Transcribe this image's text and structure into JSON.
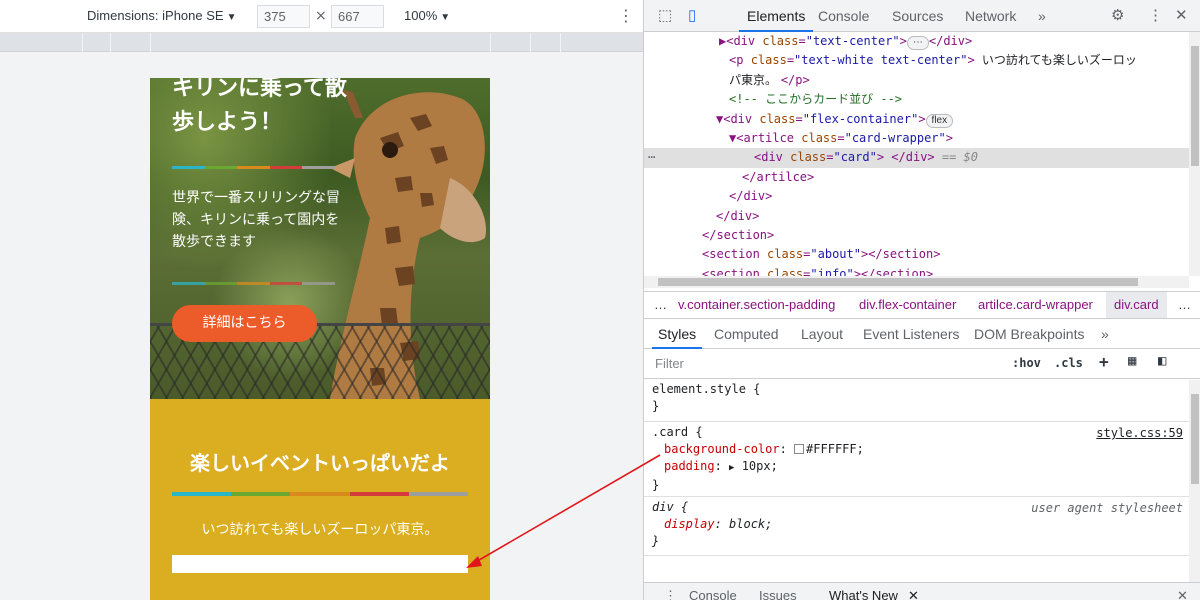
{
  "device_toolbar": {
    "dimensions_label": "Dimensions: iPhone SE",
    "width_value": "375",
    "times": "×",
    "height_value": "667",
    "zoom_label": "100%"
  },
  "page": {
    "hero_title": "キリンに乗って散歩しよう！",
    "hero_text": "世界で一番スリリングな冒険、キリンに乗って園内を散歩できます",
    "cta_label": "詳細はこちら",
    "events_title": "楽しいイベントいっぱいだよ",
    "events_text": "いつ訪れても楽しいズーロッパ東京。",
    "colors": {
      "events_bg": "#dbae22",
      "cta_bg": "#ec5b2a",
      "bar": [
        "#2bb5c8",
        "#6aa832",
        "#d88a1c",
        "#d63b3b",
        "#9e9e9e"
      ]
    }
  },
  "devtools": {
    "tabs": [
      "Elements",
      "Console",
      "Sources",
      "Network"
    ],
    "more": "»",
    "dom_lines": [
      {
        "parts": [
          [
            "tag",
            "▶<div "
          ],
          [
            "attr",
            "class"
          ],
          [
            "tag",
            "="
          ],
          [
            "val",
            "\"text-center\""
          ],
          [
            "tag",
            ">"
          ],
          [
            "pill",
            "⋯"
          ],
          [
            "tag",
            "</div>"
          ]
        ]
      },
      {
        "parts": [
          [
            "tag",
            "<p "
          ],
          [
            "attr",
            "class"
          ],
          [
            "tag",
            "="
          ],
          [
            "val",
            "\"text-white text-center\""
          ],
          [
            "tag",
            "> "
          ],
          [
            "txt",
            "いつ訪れても楽しいズーロッ"
          ]
        ]
      },
      {
        "parts": [
          [
            "txt",
            "パ東京。 "
          ],
          [
            "tag",
            "</p>"
          ]
        ]
      },
      {
        "parts": [
          [
            "cmt",
            "<!-- ここからカード並び -->"
          ]
        ]
      },
      {
        "parts": [
          [
            "tag",
            "▼<div "
          ],
          [
            "attr",
            "class"
          ],
          [
            "tag",
            "="
          ],
          [
            "val",
            "\"flex-container\""
          ],
          [
            "tag",
            ">"
          ],
          [
            "pill",
            "flex"
          ]
        ]
      },
      {
        "parts": [
          [
            "tag",
            "▼<artilce "
          ],
          [
            "attr",
            "class"
          ],
          [
            "tag",
            "="
          ],
          [
            "val",
            "\"card-wrapper\""
          ],
          [
            "tag",
            ">"
          ]
        ]
      },
      {
        "parts": [
          [
            "tag",
            "<div "
          ],
          [
            "attr",
            "class"
          ],
          [
            "tag",
            "="
          ],
          [
            "val",
            "\"card\""
          ],
          [
            "tag",
            "> </div>"
          ],
          [
            "dim",
            " == $0"
          ]
        ]
      },
      {
        "parts": [
          [
            "tag",
            "</artilce>"
          ]
        ]
      },
      {
        "parts": [
          [
            "tag",
            "</div>"
          ]
        ]
      },
      {
        "parts": [
          [
            "tag",
            "</div>"
          ]
        ]
      },
      {
        "parts": [
          [
            "tag",
            "</section>"
          ]
        ]
      },
      {
        "parts": [
          [
            "tag",
            "<section "
          ],
          [
            "attr",
            "class"
          ],
          [
            "tag",
            "="
          ],
          [
            "val",
            "\"about\""
          ],
          [
            "tag",
            "></section>"
          ]
        ]
      },
      {
        "parts": [
          [
            "tag",
            "<section "
          ],
          [
            "attr",
            "class"
          ],
          [
            "tag",
            "="
          ],
          [
            "val",
            "\"info\""
          ],
          [
            "tag",
            "></section>"
          ]
        ]
      }
    ],
    "breadcrumbs": [
      "…",
      "v.container.section-padding",
      "div.flex-container",
      "artilce.card-wrapper",
      "div.card",
      "…"
    ],
    "subtabs": [
      "Styles",
      "Computed",
      "Layout",
      "Event Listeners",
      "DOM Breakpoints",
      "»"
    ],
    "filter_placeholder": "Filter",
    "hov": ":hov",
    "cls": ".cls",
    "plus": "+",
    "rules": {
      "element_style": "element.style {",
      "close": "}",
      "card_selector": ".card {",
      "card_source": "style.css:59",
      "bg_name": "background-color",
      "bg_value": "#FFFFFF;",
      "padding_name": "padding",
      "padding_value": "10px;",
      "div_selector": "div {",
      "div_source": "user agent stylesheet",
      "display_name": "display",
      "display_value": "block;"
    },
    "drawer": [
      "Console",
      "Issues",
      "What's New"
    ]
  }
}
